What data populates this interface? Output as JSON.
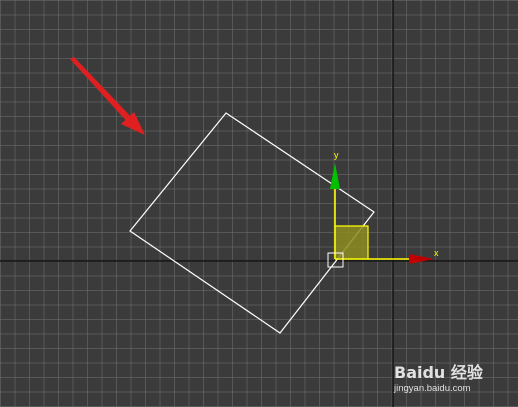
{
  "viewport": {
    "background_color": "#3c3b3b",
    "grid_color": "#6e6e6e",
    "world_axis_color": "#000000",
    "shape_outline_color": "#ffffff",
    "selection_box_color": "#ffffff"
  },
  "gizmo": {
    "x_axis_label": "x",
    "y_axis_label": "y",
    "x_axis_color": "#ffff00",
    "x_arrow_color": "#c00000",
    "y_axis_color": "#ffff00",
    "y_arrow_color": "#00c000",
    "plane_handle_color": "#8c8c20"
  },
  "annotation": {
    "arrow_color": "#e02020"
  },
  "watermark": {
    "brand_text": "Baidu 经验",
    "url_text": "jingyan.baidu.com"
  }
}
